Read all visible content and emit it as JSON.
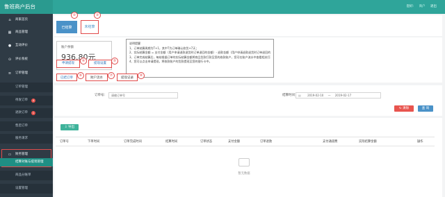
{
  "app": {
    "title": "鲁班商户后台",
    "top_right": {
      "greeting": "您好:",
      "account": "商户",
      "logout": "退出"
    }
  },
  "sidebar": {
    "items": [
      {
        "label": "商家首页",
        "icon": "home-icon"
      },
      {
        "label": "商品管理",
        "icon": "shop-icon"
      },
      {
        "label": "互动评价",
        "icon": "user-icon"
      },
      {
        "label": "评价系统",
        "icon": "star-icon"
      },
      {
        "label": "订单管理",
        "icon": "list-icon"
      }
    ],
    "sub_items": [
      {
        "label": "订单管理"
      },
      {
        "label": "待发订单",
        "badge": "4"
      },
      {
        "label": "退款订单",
        "badge": "1"
      },
      {
        "label": "售后订单"
      },
      {
        "label": "服务请求"
      }
    ],
    "finance": {
      "label": "财务管理",
      "icon": "card-icon"
    },
    "finance_sub": {
      "label": "结算对账与提现管理"
    },
    "more_items": [
      {
        "label": "商品分账单"
      },
      {
        "label": "设置管理"
      }
    ]
  },
  "top_tabs": [
    {
      "label": "已结算",
      "num": "②"
    },
    {
      "label": "未结算",
      "num": "③"
    }
  ],
  "account": {
    "label": "账户余额",
    "amount": "936.80元",
    "withdraw": "申请提现",
    "withdraw_num": "④",
    "settings": "提现设置",
    "settings_num": "⑤"
  },
  "notes": {
    "title": "说明提醒",
    "lines": [
      "1、订单结算周期为T+1，其中T为订单确认收货+7天；",
      "2、实际结算金额 = 支付金额（用户申请退款退货时订单退回的金额）- 退款金额（用户申请退款退货时订单退回的金额）- 支付手续费；",
      "3、订单完成结算后，每结根据订单的实际结算金额将商品货款打款至您的收款账户，您可在账户流水中查看相关打款记录；",
      "4、您可以点击申请提现，将收款账户的货款提现至您的银行卡中。"
    ]
  },
  "sub_tabs": [
    {
      "label": "已结订单",
      "num": "⑥"
    },
    {
      "label": "财户流水",
      "num": "⑦"
    },
    {
      "label": "提现记录",
      "num": "⑧"
    }
  ],
  "filters": {
    "order_label": "订单号：",
    "order_placeholder": "请输订单号",
    "time_label": "结算时间：",
    "date_start": "2019-02-10",
    "date_sep": "—",
    "date_end": "2019-02-17",
    "clear": "清除",
    "search": "查 询",
    "export": "导出"
  },
  "table": {
    "headers": [
      "订单号",
      "下单时间",
      "订单完成时间",
      "结算时间",
      "订单状态",
      "支付金额",
      "订单退款",
      "支付通道费",
      "实际结算金额",
      "操作"
    ],
    "empty": "暂无数据"
  },
  "colors": {
    "brand": "#2fa59a",
    "sidebar": "#2f3b45",
    "primary": "#4a92c8",
    "danger": "#e8544e",
    "annotation": "#e04848"
  }
}
